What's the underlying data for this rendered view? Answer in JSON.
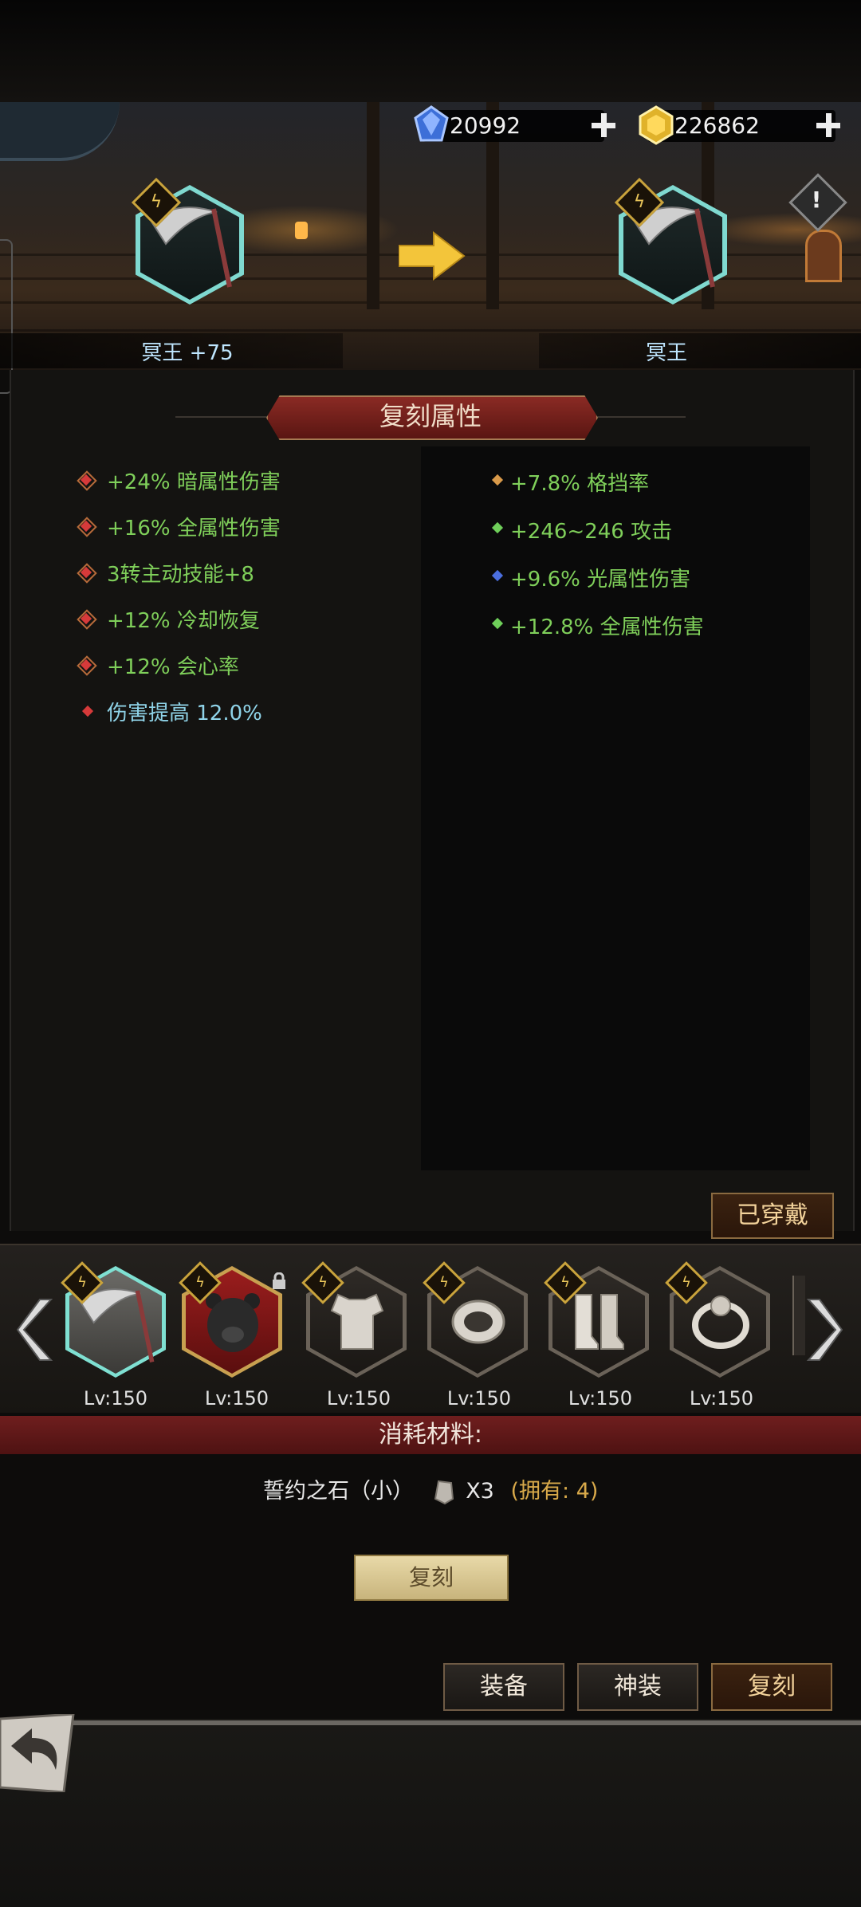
{
  "currency": {
    "gems": "20992",
    "gold": "226862"
  },
  "upgrade": {
    "left_name": "冥王 +75",
    "right_name": "冥王"
  },
  "section_title": "复刻属性",
  "attributes_left": [
    {
      "text": "+24% 暗属性伤害",
      "icon": "red-ring-diamond-icon"
    },
    {
      "text": "+16% 全属性伤害",
      "icon": "red-ring-diamond-icon"
    },
    {
      "text": "3转主动技能+8",
      "icon": "red-ring-diamond-icon"
    },
    {
      "text": "+12% 冷却恢复",
      "icon": "red-ring-diamond-icon"
    },
    {
      "text": "+12% 会心率",
      "icon": "red-ring-diamond-icon"
    },
    {
      "text": "伤害提高 12.0%",
      "icon": "red-diamond-icon"
    }
  ],
  "attributes_right": [
    {
      "text": "+7.8% 格挡率",
      "icon": "orange-diamond-icon",
      "color": "#d99a4a"
    },
    {
      "text": "+246~246 攻击",
      "icon": "green-diamond-icon",
      "color": "#6fcf5a"
    },
    {
      "text": "+9.6% 光属性伤害",
      "icon": "blue-diamond-icon",
      "color": "#4b6fe0"
    },
    {
      "text": "+12.8% 全属性伤害",
      "icon": "green-diamond-icon",
      "color": "#6fcf5a"
    }
  ],
  "equipped_label": "已穿戴",
  "equipment": [
    {
      "icon": "scythe-icon",
      "level": "Lv:150"
    },
    {
      "icon": "bear-helmet-icon",
      "level": "Lv:150"
    },
    {
      "icon": "armor-icon",
      "level": "Lv:150"
    },
    {
      "icon": "belt-icon",
      "level": "Lv:150"
    },
    {
      "icon": "boots-icon",
      "level": "Lv:150"
    },
    {
      "icon": "ring-icon",
      "level": "Lv:150"
    }
  ],
  "materials": {
    "title": "消耗材料:",
    "name": "誓约之石（小）",
    "quantity": "X3",
    "owned": "(拥有: 4)"
  },
  "buttons": {
    "replicate": "复刻",
    "tab_equip": "装备",
    "tab_divine": "神装",
    "tab_replicate": "复刻"
  },
  "colors": {
    "attr_green": "#7fcf5a",
    "attr_blue": "#8fd3e8",
    "material_band": "#6f1e1e",
    "owned_gold": "#d8a94a"
  }
}
